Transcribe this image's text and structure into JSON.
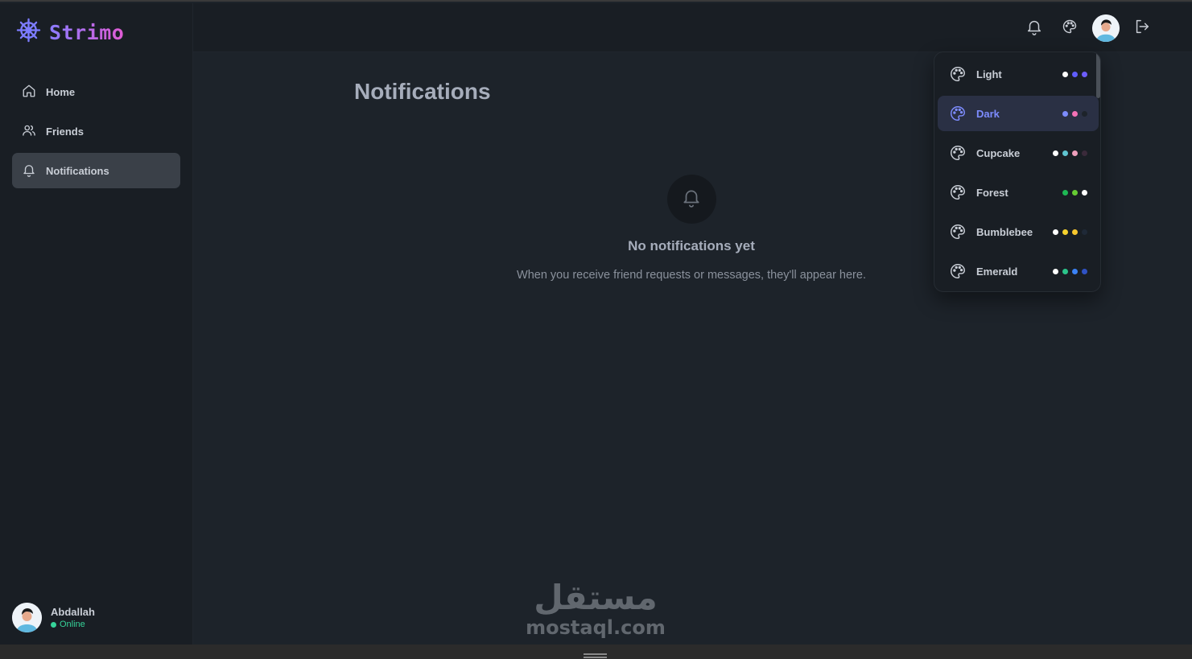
{
  "brand": {
    "name": "Strimo",
    "accent_from": "#8a7cff",
    "accent_to": "#e05bd4"
  },
  "sidebar": {
    "items": [
      {
        "label": "Home",
        "icon": "home-icon",
        "active": false
      },
      {
        "label": "Friends",
        "icon": "users-icon",
        "active": false
      },
      {
        "label": "Notifications",
        "icon": "bell-icon",
        "active": true
      }
    ],
    "user": {
      "name": "Abdallah",
      "status": "Online",
      "status_color": "#36d399"
    }
  },
  "topbar": {
    "icons": [
      "bell-icon",
      "palette-icon",
      "avatar",
      "logout-icon"
    ]
  },
  "main": {
    "title": "Notifications",
    "empty_state": {
      "title": "No notifications yet",
      "text": "When you receive friend requests or messages, they'll appear here."
    }
  },
  "theme_menu": {
    "themes": [
      {
        "label": "Light",
        "active": false,
        "colors": [
          "#ffffff",
          "#605dff",
          "#6d5dfc"
        ]
      },
      {
        "label": "Dark",
        "active": true,
        "colors": [
          "#7d8cff",
          "#f472b6",
          "#1d232a"
        ]
      },
      {
        "label": "Cupcake",
        "active": false,
        "colors": [
          "#ffffff",
          "#5fc5d1",
          "#ef9fbc",
          "#3a2a3a"
        ]
      },
      {
        "label": "Forest",
        "active": false,
        "colors": [
          "#1eb854",
          "#66cc33",
          "#ffffff"
        ]
      },
      {
        "label": "Bumblebee",
        "active": false,
        "colors": [
          "#ffffff",
          "#f5d22e",
          "#f7c72e",
          "#1f2937"
        ]
      },
      {
        "label": "Emerald",
        "active": false,
        "colors": [
          "#ffffff",
          "#2bc48a",
          "#3b82f6",
          "#2f52c4"
        ]
      }
    ]
  },
  "watermark": {
    "arabic": "مستقل",
    "latin": "mostaql.com"
  }
}
